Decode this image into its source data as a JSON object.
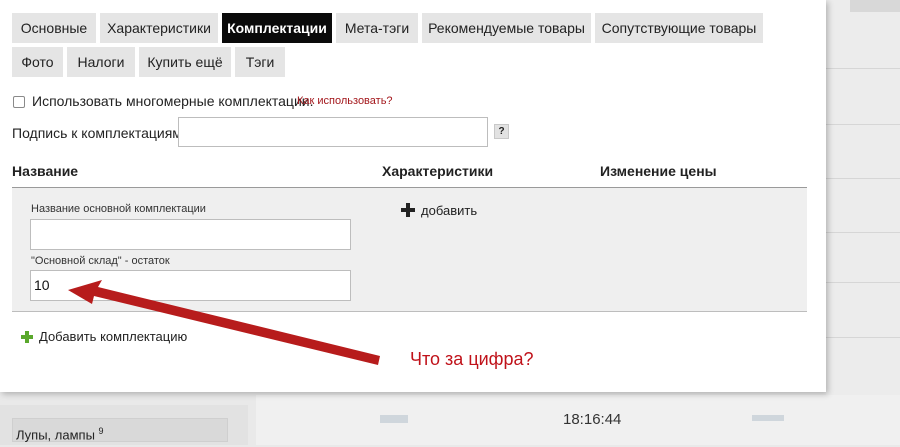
{
  "tabs": [
    {
      "label": "Основные",
      "active": false
    },
    {
      "label": "Характеристики",
      "active": false
    },
    {
      "label": "Комплектации",
      "active": true
    },
    {
      "label": "Мета-тэги",
      "active": false
    },
    {
      "label": "Рекомендуемые товары",
      "active": false
    },
    {
      "label": "Сопутствующие товары",
      "active": false
    },
    {
      "label": "Фото",
      "active": false
    },
    {
      "label": "Налоги",
      "active": false
    },
    {
      "label": "Купить ещё",
      "active": false
    },
    {
      "label": "Тэги",
      "active": false
    }
  ],
  "options": {
    "multidim_label": "Использовать многомерные комплектации.",
    "multidim_checked": false,
    "help_link": "Как использовать?",
    "signature_label": "Подпись к комплектациям:",
    "signature_value": "",
    "help_button": "?"
  },
  "table": {
    "col_name": "Название",
    "col_characteristics": "Характеристики",
    "col_price_change": "Изменение цены"
  },
  "kit": {
    "name_label": "Название основной комплектации",
    "name_value": "",
    "stock_label": "\"Основной склад\" - остаток",
    "stock_value": "10",
    "add_characteristic": "добавить"
  },
  "add_kit_label": "Добавить комплектацию",
  "annotation": {
    "text": "Что за цифра?",
    "color": "#c0121a"
  },
  "background": {
    "sidebar_item": "Лупы, лампы",
    "sidebar_count": "9",
    "time": "18:16:44"
  }
}
